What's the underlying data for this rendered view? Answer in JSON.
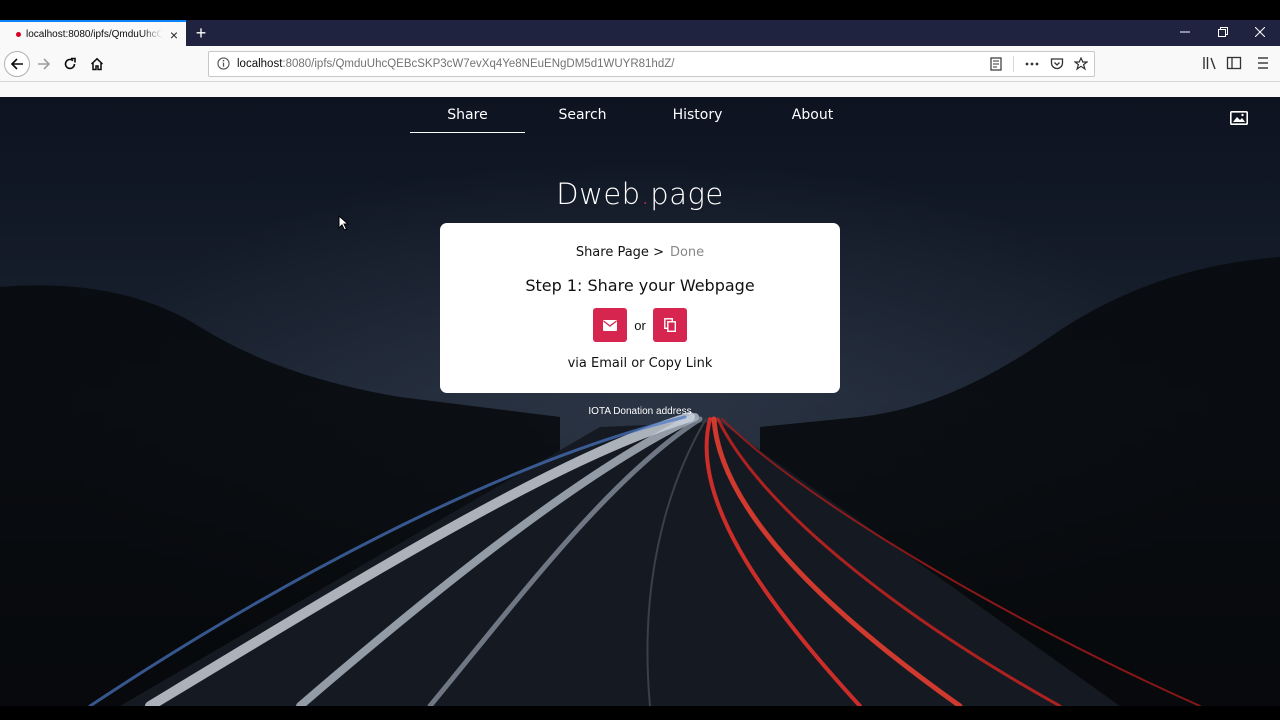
{
  "browser": {
    "tab_title": "localhost:8080/ipfs/QmduUhcQEBcSKP3cW7evXq4Ye8NEuENgDM5d1WUYR81hdZ/",
    "url_host": "localhost",
    "url_rest": ":8080/ipfs/QmduUhcQEBcSKP3cW7evXq4Ye8NEuENgDM5d1WUYR81hdZ/",
    "new_tab_label": "+",
    "close_tab_label": "×",
    "accent_color": "#0a84ff"
  },
  "site_nav": {
    "items": [
      {
        "label": "Share"
      },
      {
        "label": "Search"
      },
      {
        "label": "History"
      },
      {
        "label": "About"
      }
    ],
    "active": "Share"
  },
  "logo": {
    "part1": "Dweb",
    "dot": ".",
    "part2": "page"
  },
  "card": {
    "crumb_current": "Share Page >",
    "crumb_next": "Done",
    "step_title": "Step 1: Share your Webpage",
    "or_label": "or",
    "via_text": "via Email or Copy Link"
  },
  "footer": {
    "donation": "IOTA Donation address"
  },
  "colors": {
    "brand": "#d6254f",
    "page_bg": "#0c1018"
  },
  "icons": [
    "info-icon",
    "reader-icon",
    "more-icon",
    "pocket-icon",
    "star-icon",
    "library-icon",
    "sidebar-icon",
    "menu-icon",
    "email-icon",
    "copy-icon",
    "wallpaper-icon"
  ]
}
